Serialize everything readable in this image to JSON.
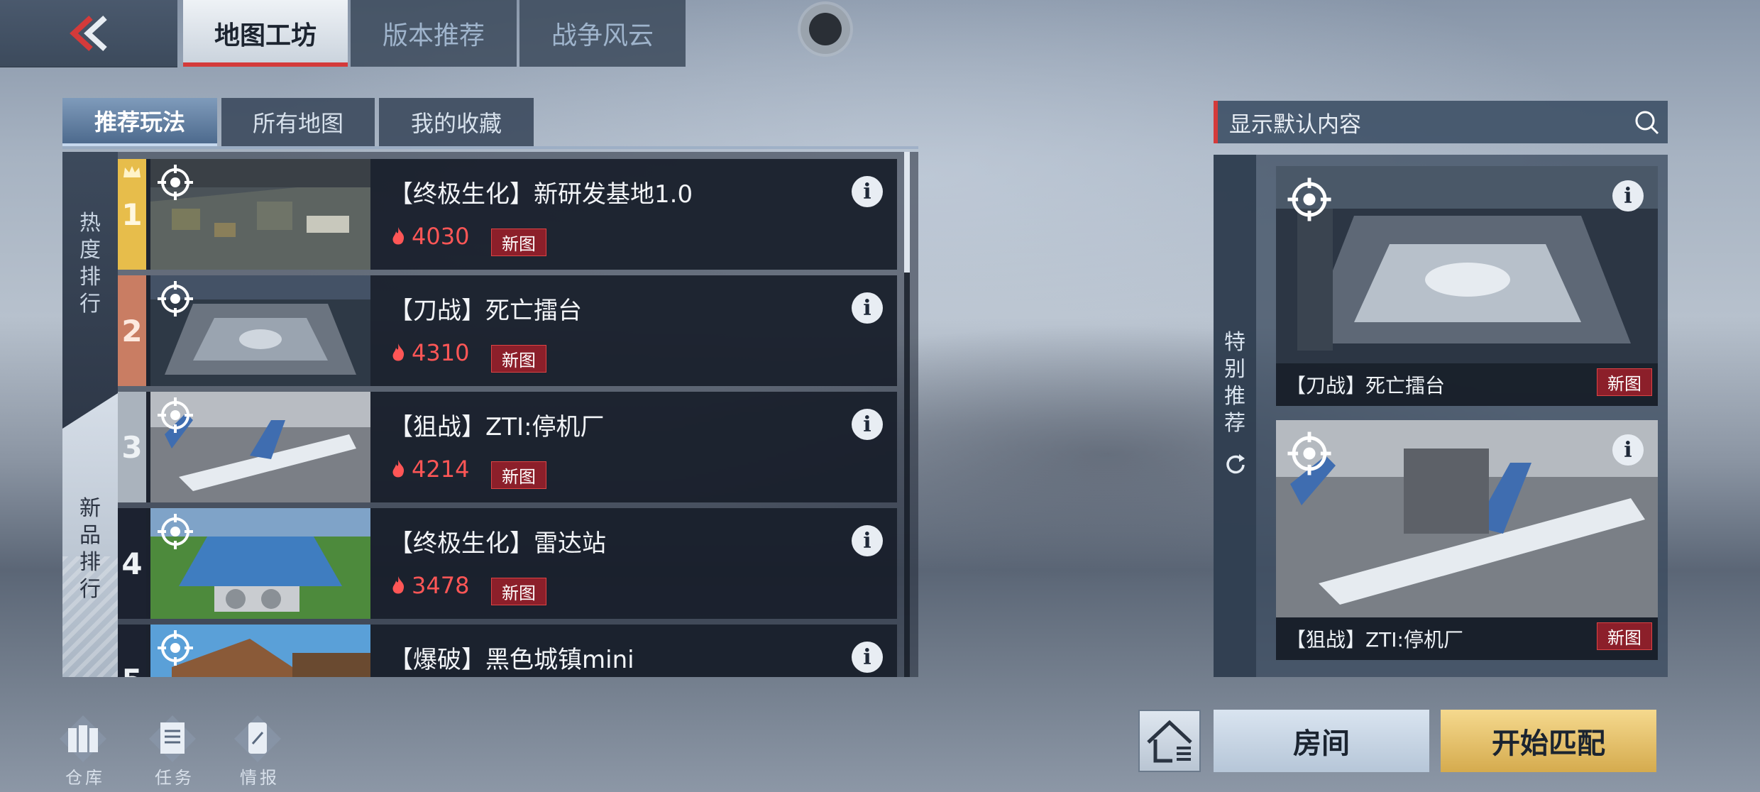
{
  "top_tabs": [
    {
      "label": "地图工坊",
      "active": true
    },
    {
      "label": "版本推荐",
      "active": false
    },
    {
      "label": "战争风云",
      "active": false
    }
  ],
  "sub_tabs": [
    {
      "label": "推荐玩法",
      "active": true
    },
    {
      "label": "所有地图",
      "active": false
    },
    {
      "label": "我的收藏",
      "active": false
    }
  ],
  "side_tabs": {
    "hot": "热度排行",
    "new": "新品排行"
  },
  "rank_colors": {
    "1": "#e7bd4b",
    "2": "#c97d63",
    "3": "#aab3bd",
    "other": "#1c2230"
  },
  "map_list": [
    {
      "rank": "1",
      "title": "【终极生化】新研发基地1.0",
      "heat": "4030",
      "badge": "新图"
    },
    {
      "rank": "2",
      "title": "【刀战】死亡擂台",
      "heat": "4310",
      "badge": "新图"
    },
    {
      "rank": "3",
      "title": "【狙战】ZTI:停机厂",
      "heat": "4214",
      "badge": "新图"
    },
    {
      "rank": "4",
      "title": "【终极生化】雷达站",
      "heat": "3478",
      "badge": "新图"
    },
    {
      "rank": "5",
      "title": "【爆破】黑色城镇mini",
      "heat": "",
      "badge": ""
    }
  ],
  "search": {
    "placeholder": "显示默认内容"
  },
  "recommend": {
    "label": "特别推荐",
    "cards": [
      {
        "title": "【刀战】死亡擂台",
        "badge": "新图"
      },
      {
        "title": "【狙战】ZTI:停机厂",
        "badge": "新图"
      }
    ]
  },
  "bottom_nav": [
    {
      "label": "仓库",
      "icon": "warehouse-icon"
    },
    {
      "label": "任务",
      "icon": "task-list-icon"
    },
    {
      "label": "情报",
      "icon": "intel-phone-icon"
    }
  ],
  "buttons": {
    "room": "房间",
    "start_match": "开始匹配"
  }
}
